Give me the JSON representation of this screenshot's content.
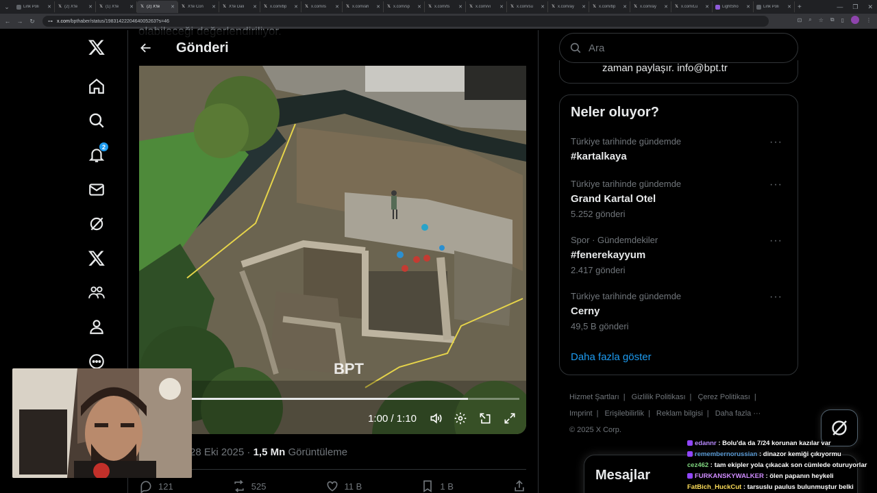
{
  "browser": {
    "tabs": [
      {
        "title": "Link Poli",
        "icon": "page-icon",
        "active": false
      },
      {
        "title": "(2) X'te",
        "icon": "x-icon",
        "active": false
      },
      {
        "title": "(1) X'te",
        "icon": "x-icon",
        "active": false
      },
      {
        "title": "(2) X'te",
        "icon": "x-icon",
        "active": true
      },
      {
        "title": "X'te Con",
        "icon": "x-icon",
        "active": false
      },
      {
        "title": "X'te Dali",
        "icon": "x-icon",
        "active": false
      },
      {
        "title": "x.com/bp",
        "icon": "x-icon",
        "active": false
      },
      {
        "title": "x.com/is",
        "icon": "x-icon",
        "active": false
      },
      {
        "title": "x.com/ah",
        "icon": "x-icon",
        "active": false
      },
      {
        "title": "x.com/sp",
        "icon": "x-icon",
        "active": false
      },
      {
        "title": "x.com/ts",
        "icon": "x-icon",
        "active": false
      },
      {
        "title": "x.com/vi",
        "icon": "x-icon",
        "active": false
      },
      {
        "title": "x.com/su",
        "icon": "x-icon",
        "active": false
      },
      {
        "title": "x.com/ay",
        "icon": "x-icon",
        "active": false
      },
      {
        "title": "x.com/bp",
        "icon": "x-icon",
        "active": false
      },
      {
        "title": "x.com/ay",
        "icon": "x-icon",
        "active": false
      },
      {
        "title": "x.com/Lu",
        "icon": "x-icon",
        "active": false
      },
      {
        "title": "LightSho",
        "icon": "lightshot-icon",
        "active": false
      },
      {
        "title": "Link Poli",
        "icon": "page-icon",
        "active": false
      }
    ],
    "url_host": "x.com",
    "url_path": "/bpthaber/status/1983142220464005263?s=46"
  },
  "nav": {
    "notifications_badge": "2",
    "items": [
      "x-logo-icon",
      "home-icon",
      "explore-icon",
      "notifications-icon",
      "messages-icon",
      "grok-icon",
      "premium-icon",
      "communities-icon",
      "profile-icon",
      "more-icon"
    ]
  },
  "post": {
    "cut_text": "olabileceği değerlendiriliyor.",
    "header_title": "Gönderi",
    "video": {
      "time": "1:00 / 1:10",
      "progress": 0.857,
      "watermark": "BPT"
    },
    "date": "28 Eki 2025",
    "views": "1,5 Mn",
    "views_label": "Görüntüleme",
    "replies": "121",
    "reposts": "525",
    "likes": "11 B",
    "bookmarks": "1 B"
  },
  "sidebar": {
    "search_placeholder": "Ara",
    "bio_cut": "zaman paylaşır. info@bpt.tr",
    "trends_title": "Neler oluyor?",
    "trends": [
      {
        "context": "Türkiye tarihinde gündemde",
        "name": "#kartalkaya",
        "count": ""
      },
      {
        "context": "Türkiye tarihinde gündemde",
        "name": "Grand Kartal Otel",
        "count": "5.252 gönderi"
      },
      {
        "context": "Spor · Gündemdekiler",
        "name": "#fenerekayyum",
        "count": "2.417 gönderi"
      },
      {
        "context": "Türkiye tarihinde gündemde",
        "name": "Cerny",
        "count": "49,5 B gönderi"
      }
    ],
    "show_more": "Daha fazla göster",
    "footer": {
      "links": [
        "Hizmet Şartları",
        "Gizlilik Politikası",
        "Çerez Politikası",
        "Imprint",
        "Erişilebilirlik",
        "Reklam bilgisi",
        "Daha fazla ···"
      ],
      "copyright": "© 2025 X Corp."
    },
    "messages_title": "Mesajlar"
  },
  "stream_chat": [
    {
      "user": "edannr",
      "text": " : Bolu'da da 7/24 korunan kazılar var",
      "color": "#b98bff",
      "badge": true
    },
    {
      "user": "remembernorussian",
      "text": " : dinazor kemiği çıkıyormu",
      "color": "#5b9bd5",
      "badge": true
    },
    {
      "user": "cez462",
      "text": " : tam ekipler yola çıkacak son cümlede oturuyorlar",
      "color": "#7fd67f",
      "badge": false
    },
    {
      "user": "FURKANSKYWALKER",
      "text": " : ölen papanın heykeli",
      "color": "#d08cff",
      "badge": true
    },
    {
      "user": "FatBich_HuckCut",
      "text": " : tarsuslu paulus bulunmuştur belki",
      "color": "#ffde59",
      "badge": false
    }
  ]
}
